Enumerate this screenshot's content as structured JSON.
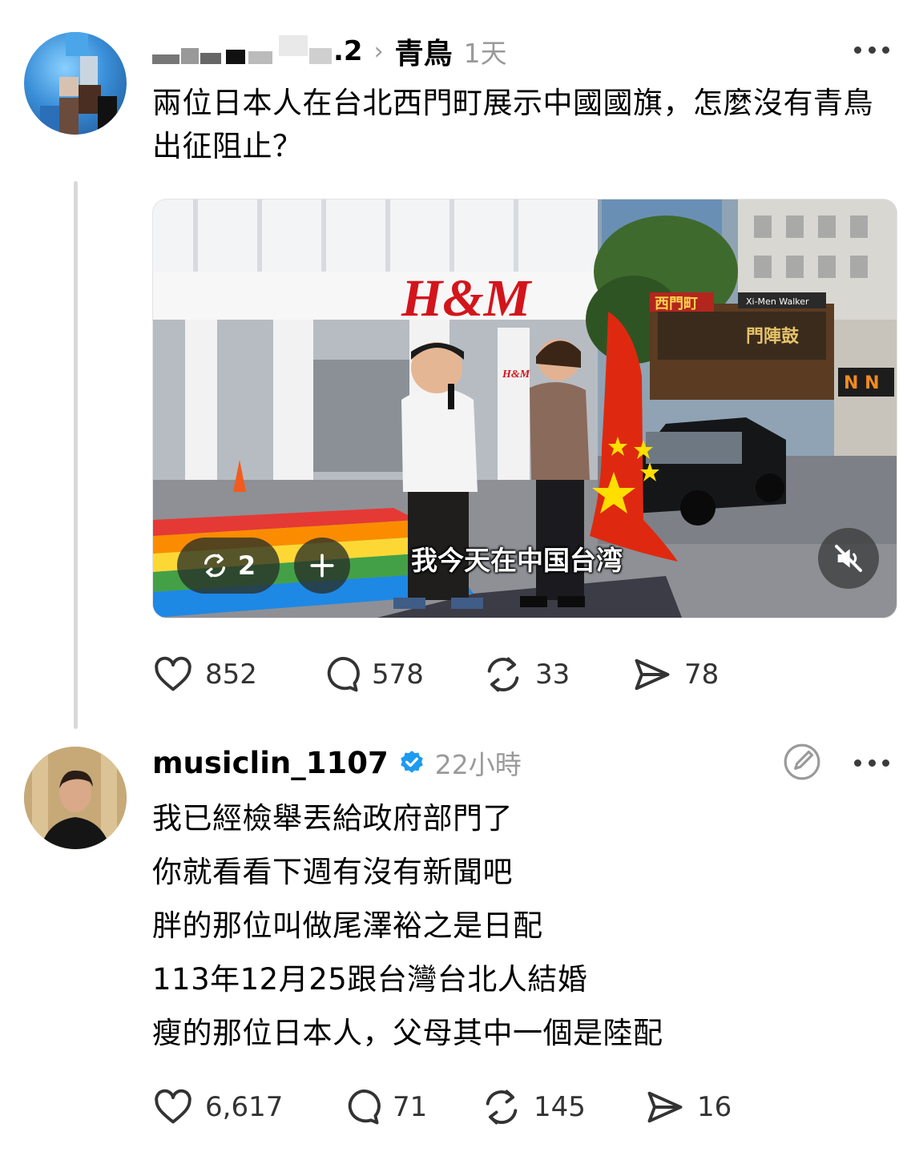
{
  "post1": {
    "username_suffix": ".2",
    "topic": "青鳥",
    "time": "1天",
    "text": "兩位日本人在台北西門町展示中國國旗，怎麼沒有青鳥出征阻止？",
    "media": {
      "store_sign": "H&M",
      "store_sign_small": "H&M",
      "gate_sign": "西門町",
      "gate_sign_en": "Xi-Men Walker",
      "billboard_text": "門陣鼓",
      "shop_sign": "N N",
      "subtitle": "我今天在中国台湾",
      "repost_count": "2"
    },
    "stats": {
      "likes": "852",
      "replies": "578",
      "reposts": "33",
      "shares": "78"
    }
  },
  "post2": {
    "username": "musiclin_1107",
    "time": "22小時",
    "lines": [
      "我已經檢舉丟給政府部門了",
      "你就看看下週有沒有新聞吧",
      "胖的那位叫做尾澤裕之是日配",
      "113年12月25跟台灣台北人結婚",
      "瘦的那位日本人，父母其中一個是陸配"
    ],
    "stats": {
      "likes": "6,617",
      "replies": "71",
      "reposts": "145",
      "shares": "16"
    }
  },
  "icons": {
    "like": "heart-icon",
    "reply": "comment-bubble-icon",
    "repost": "repost-arrows-icon",
    "share": "send-arrow-icon",
    "more": "more-dots-icon",
    "verified": "verified-badge-icon",
    "edit": "edit-pencil-icon",
    "mute": "speaker-muted-icon",
    "add": "plus-icon"
  },
  "colors": {
    "text": "#000000",
    "muted": "#9a9a9a",
    "icon": "#333333",
    "verified": "#1d9bf0",
    "flag_red": "#de2910",
    "flag_star": "#ffde00"
  }
}
